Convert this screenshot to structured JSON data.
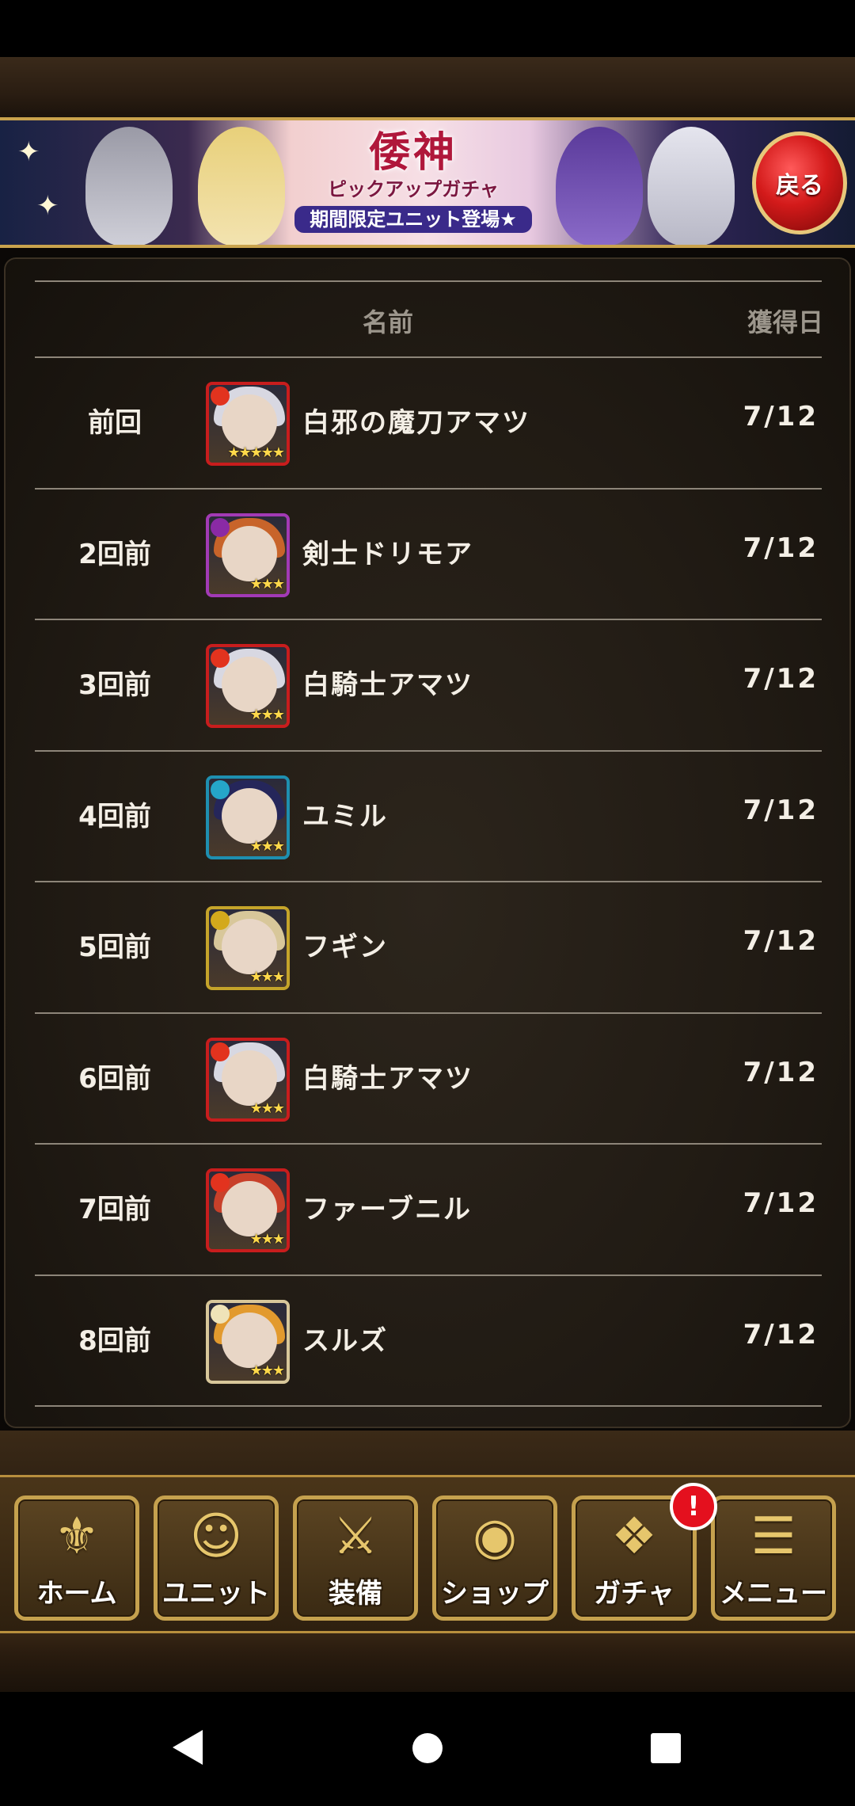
{
  "banner": {
    "title": "倭神",
    "subtitle": "ピックアップガチャ",
    "caption": "期間限定ユニット登場★",
    "back_label": "戻る"
  },
  "table": {
    "headers": {
      "name": "名前",
      "date": "獲得日"
    },
    "rows": [
      {
        "rank": "前回",
        "name": "白邪の魔刀アマツ",
        "date": "7/12",
        "element": "fire",
        "frame_color": "#c81d1d",
        "hair_color": "#d8d8e2",
        "stars": 5
      },
      {
        "rank": "2回前",
        "name": "剣士ドリモア",
        "date": "7/12",
        "element": "dark",
        "frame_color": "#a23ab5",
        "hair_color": "#c8642a",
        "stars": 3
      },
      {
        "rank": "3回前",
        "name": "白騎士アマツ",
        "date": "7/12",
        "element": "fire",
        "frame_color": "#c81d1d",
        "hair_color": "#d8d8e2",
        "stars": 3
      },
      {
        "rank": "4回前",
        "name": "ユミル",
        "date": "7/12",
        "element": "water",
        "frame_color": "#1e8fb0",
        "hair_color": "#25265a",
        "stars": 3
      },
      {
        "rank": "5回前",
        "name": "フギン",
        "date": "7/12",
        "element": "thunder",
        "frame_color": "#c5a42a",
        "hair_color": "#d8c79a",
        "stars": 3
      },
      {
        "rank": "6回前",
        "name": "白騎士アマツ",
        "date": "7/12",
        "element": "fire",
        "frame_color": "#c81d1d",
        "hair_color": "#d8d8e2",
        "stars": 3
      },
      {
        "rank": "7回前",
        "name": "ファーブニル",
        "date": "7/12",
        "element": "fire",
        "frame_color": "#c81d1d",
        "hair_color": "#c8402a",
        "stars": 3
      },
      {
        "rank": "8回前",
        "name": "スルズ",
        "date": "7/12",
        "element": "light",
        "frame_color": "#d8c79a",
        "hair_color": "#e29a2e",
        "stars": 3
      }
    ]
  },
  "nav": {
    "items": [
      {
        "label": "ホーム",
        "icon": "home-crest-icon"
      },
      {
        "label": "ユニット",
        "icon": "unit-icon"
      },
      {
        "label": "装備",
        "icon": "crossed-swords-icon"
      },
      {
        "label": "ショップ",
        "icon": "shop-coin-icon"
      },
      {
        "label": "ガチャ",
        "icon": "gacha-cards-icon"
      },
      {
        "label": "メニュー",
        "icon": "menu-lines-icon"
      }
    ],
    "badge": "!"
  },
  "colors": {
    "accent_gold": "#c5a14e",
    "badge_red": "#e4101e",
    "text": "#f4efe6",
    "header_text": "#9c968c"
  }
}
